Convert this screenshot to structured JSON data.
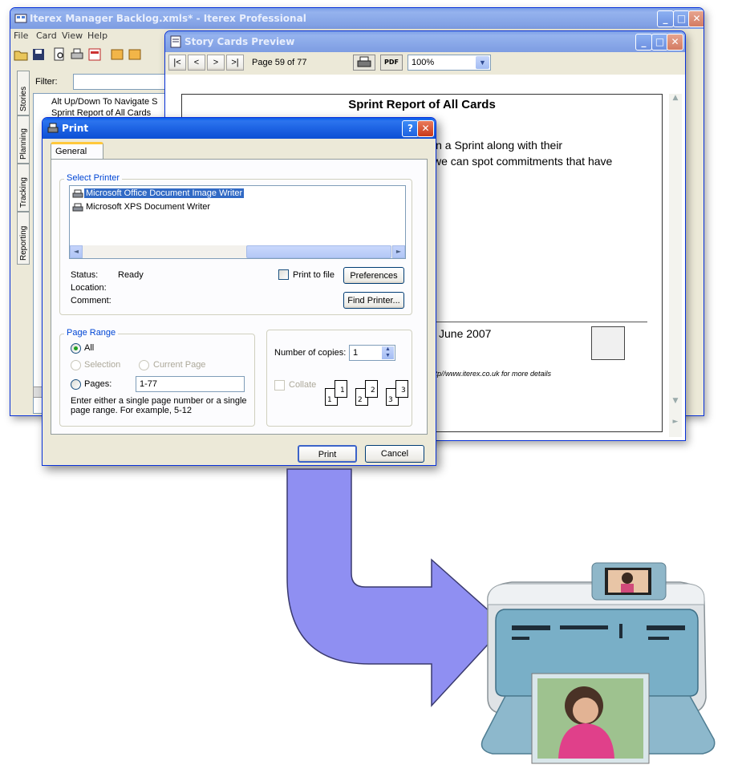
{
  "colors": {
    "xp_blue": "#0a5ce8",
    "arrow_fill": "#8f8ff2",
    "arrow_stroke": "#3a3a6e",
    "selection": "#316ac5"
  },
  "main_window": {
    "title": "Iterex Manager Backlog.xmls* - Iterex Professional",
    "menu": [
      "File",
      "Card",
      "View",
      "Help"
    ],
    "filter_label": "Filter:",
    "vertical_tabs": [
      "Stories",
      "Planning",
      "Tracking",
      "Reporting"
    ],
    "list_items": [
      "Alt Up/Down To Navigate S",
      "Sprint Report of All Cards"
    ]
  },
  "preview_window": {
    "title": "Story Cards Preview",
    "nav": {
      "first": "|<",
      "prev": "<",
      "next": ">",
      "last": ">|"
    },
    "page_label": "Page 59 of 77",
    "pdf_label": "PDF",
    "zoom": "100%",
    "report_title": "Sprint Report of All Cards",
    "text_line1": "in a Sprint along with their",
    "text_line2": "we can spot commitments that have",
    "date_text": "June 2007",
    "footer_text": "http//www.iterex.co.uk for more details"
  },
  "print_dialog": {
    "title": "Print",
    "tab_general": "General",
    "select_printer_label": "Select Printer",
    "printers": [
      {
        "name": "Microsoft Office Document Image Writer",
        "selected": true
      },
      {
        "name": "Microsoft XPS Document Writer",
        "selected": false
      }
    ],
    "status_label": "Status:",
    "status_value": "Ready",
    "location_label": "Location:",
    "comment_label": "Comment:",
    "print_to_file_label": "Print to file",
    "preferences_label": "Preferences",
    "find_printer_label": "Find Printer...",
    "page_range_label": "Page Range",
    "all_label": "All",
    "selection_label": "Selection",
    "current_page_label": "Current Page",
    "pages_label": "Pages:",
    "pages_value": "1-77",
    "range_help": "Enter either a single page number or a single page range.  For example, 5-12",
    "copies_label": "Number of copies:",
    "copies_value": "1",
    "collate_label": "Collate",
    "collate_pages": [
      "1",
      "1",
      "2",
      "2",
      "3",
      "3"
    ],
    "print_button": "Print",
    "cancel_button": "Cancel"
  }
}
